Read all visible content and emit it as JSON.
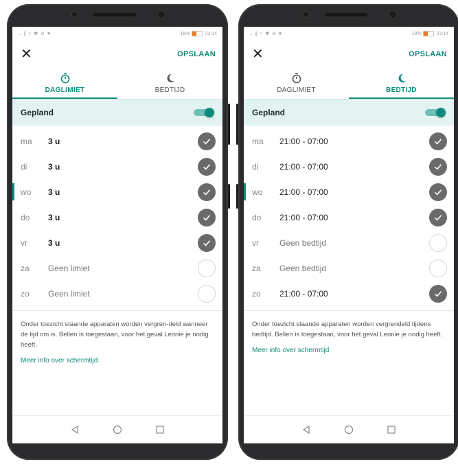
{
  "screens": [
    {
      "status": {
        "icons": "…∥ ≈ ✱ ⊘ ♥",
        "battery": "18%",
        "time": "23:14"
      },
      "header": {
        "close_label": "✕",
        "save_label": "OPSLAAN"
      },
      "tabs": [
        {
          "label": "DAGLIMIET",
          "icon": "stopwatch-icon",
          "active": true
        },
        {
          "label": "BEDTIJD",
          "icon": "moon-icon",
          "active": false
        }
      ],
      "schedule": {
        "label": "Gepland",
        "enabled": true
      },
      "days": [
        {
          "abbr": "ma",
          "value": "3 u",
          "checked": true,
          "today": false
        },
        {
          "abbr": "di",
          "value": "3 u",
          "checked": true,
          "today": false
        },
        {
          "abbr": "wo",
          "value": "3 u",
          "checked": true,
          "today": true
        },
        {
          "abbr": "do",
          "value": "3 u",
          "checked": true,
          "today": false
        },
        {
          "abbr": "vr",
          "value": "3 u",
          "checked": true,
          "today": false
        },
        {
          "abbr": "za",
          "value": "Geen limiet",
          "checked": false,
          "today": false
        },
        {
          "abbr": "zo",
          "value": "Geen limiet",
          "checked": false,
          "today": false
        }
      ],
      "info_text": "Onder toezicht staande apparaten worden vergren-deld wanneer de tijd om is. Bellen is toegestaan, voor het geval Leonie je nodig heeft.",
      "more_link": "Meer info over schermtijd"
    },
    {
      "status": {
        "icons": "…∥ ≈ ✱ ⊘ ♥",
        "battery": "18%",
        "time": "23:14"
      },
      "header": {
        "close_label": "✕",
        "save_label": "OPSLAAN"
      },
      "tabs": [
        {
          "label": "DAGLIMIET",
          "icon": "stopwatch-icon",
          "active": false
        },
        {
          "label": "BEDTIJD",
          "icon": "moon-icon",
          "active": true
        }
      ],
      "schedule": {
        "label": "Gepland",
        "enabled": true
      },
      "days": [
        {
          "abbr": "ma",
          "value": "21:00 - 07:00",
          "checked": true,
          "today": false
        },
        {
          "abbr": "di",
          "value": "21:00 - 07:00",
          "checked": true,
          "today": false
        },
        {
          "abbr": "wo",
          "value": "21:00 - 07:00",
          "checked": true,
          "today": true
        },
        {
          "abbr": "do",
          "value": "21:00 - 07:00",
          "checked": true,
          "today": false
        },
        {
          "abbr": "vr",
          "value": "Geen bedtijd",
          "checked": false,
          "today": false
        },
        {
          "abbr": "za",
          "value": "Geen bedtijd",
          "checked": false,
          "today": false
        },
        {
          "abbr": "zo",
          "value": "21:00 - 07:00",
          "checked": true,
          "today": false
        }
      ],
      "info_text": "Onder toezicht staande apparaten worden vergrendeld tijdens bedtijd. Bellen is toegestaan, voor het geval Leonie je nodig heeft.",
      "more_link": "Meer info over schermtijd"
    }
  ],
  "colors": {
    "accent": "#0e8b7c",
    "schedule_bg": "#e2f3f1",
    "check_on": "#6a6a6a",
    "battery": "#f07c1e"
  }
}
